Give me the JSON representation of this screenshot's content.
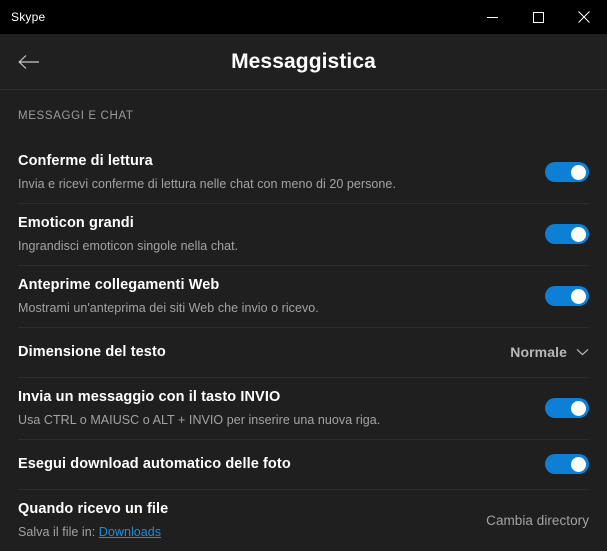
{
  "window": {
    "title": "Skype",
    "controls": [
      {
        "name": "minimize-button",
        "icon": "minimize-icon"
      },
      {
        "name": "maximize-button",
        "icon": "maximize-icon"
      },
      {
        "name": "close-button",
        "icon": "close-icon"
      }
    ]
  },
  "header": {
    "back_icon": "back-arrow-icon",
    "title": "Messaggistica"
  },
  "section": {
    "label": "MESSAGGI E CHAT"
  },
  "colors": {
    "accent_blue": "#0d7fd4",
    "link_blue": "#1a8fe0",
    "titlebar_bg": "#000000",
    "header_bg": "#202020",
    "content_bg": "#1f1f1f",
    "divider": "#2c2c2c"
  },
  "rows": [
    {
      "title": "Conferme di lettura",
      "subtitle": "Invia e ricevi conferme di lettura nelle chat con meno di 20 persone.",
      "control": "toggle",
      "state": "on"
    },
    {
      "title": "Emoticon grandi",
      "subtitle": "Ingrandisci emoticon singole nella chat.",
      "control": "toggle",
      "state": "on"
    },
    {
      "title": "Anteprime collegamenti Web",
      "subtitle": "Mostrami un'anteprima dei siti Web che invio o ricevo.",
      "control": "toggle",
      "state": "on"
    },
    {
      "title": "Dimensione del testo",
      "subtitle": "",
      "control": "dropdown",
      "value": "Normale"
    },
    {
      "title": "Invia un messaggio con il tasto INVIO",
      "subtitle": "Usa CTRL o MAIUSC o ALT + INVIO per inserire una nuova riga.",
      "control": "toggle",
      "state": "on"
    },
    {
      "title": "Esegui download automatico delle foto",
      "subtitle": "",
      "control": "toggle",
      "state": "on"
    },
    {
      "title": "Quando ricevo un file",
      "subtitle_prefix": "Salva il file in: ",
      "subtitle_link": "Downloads",
      "control": "action",
      "action_label": "Cambia directory"
    }
  ]
}
